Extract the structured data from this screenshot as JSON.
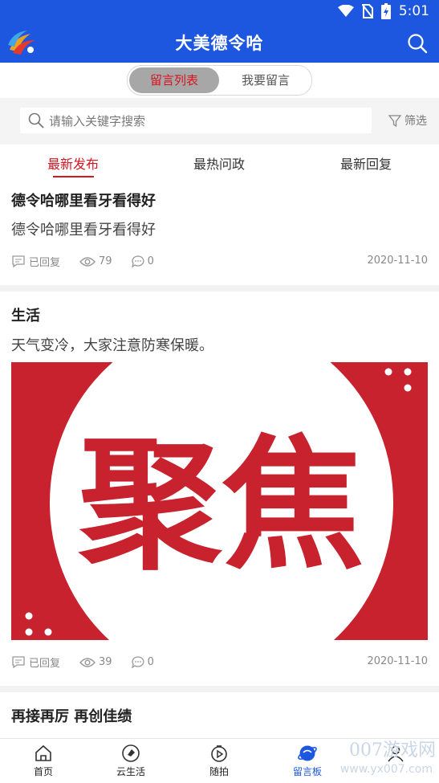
{
  "status_bar": {
    "time": "5:01"
  },
  "app": {
    "title": "大美德令哈"
  },
  "segmented": {
    "active": "留言列表",
    "inactive": "我要留言"
  },
  "search": {
    "placeholder": "请输入关键字搜索",
    "filter_label": "筛选"
  },
  "tabs": [
    {
      "label": "最新发布"
    },
    {
      "label": "最热问政"
    },
    {
      "label": "最新回复"
    }
  ],
  "posts": [
    {
      "title": "德令哈哪里看牙看得好",
      "body": "德令哈哪里看牙看得好",
      "status": "已回复",
      "views": "79",
      "comments": "0",
      "date": "2020-11-10"
    },
    {
      "title": "生活",
      "body": "天气变冷，大家注意防寒保暖。",
      "image_text": "聚焦",
      "status": "已回复",
      "views": "39",
      "comments": "0",
      "date": "2020-11-10"
    },
    {
      "title": "再接再厉 再创佳绩"
    }
  ],
  "bottom_nav": [
    {
      "label": "首页",
      "icon": "home-icon"
    },
    {
      "label": "云生活",
      "icon": "tag-icon"
    },
    {
      "label": "随拍",
      "icon": "camera-play-icon"
    },
    {
      "label": "留言板",
      "icon": "planet-icon"
    },
    {
      "label": "",
      "icon": "person-icon"
    }
  ],
  "watermark": {
    "line1": "007游戏网",
    "line2": "www.yx007.com"
  },
  "colors": {
    "brand": "#1d57e0",
    "accent": "#d6151f",
    "poster_red": "#c8222f"
  }
}
